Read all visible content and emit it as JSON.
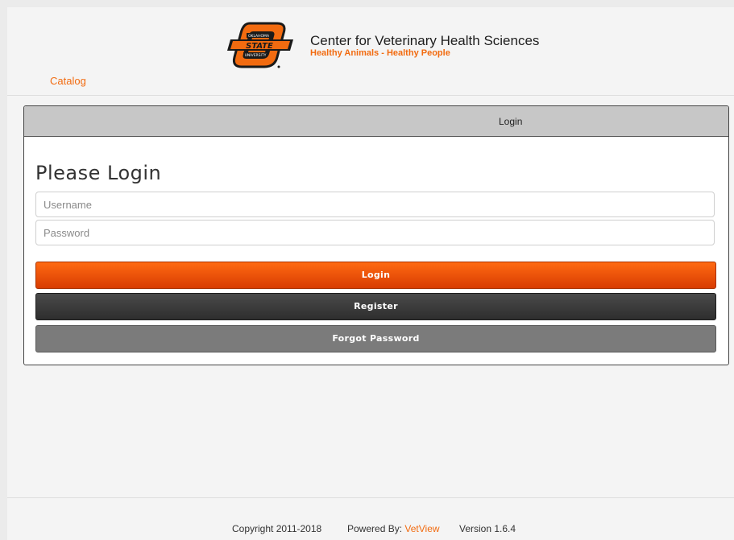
{
  "header": {
    "logo_text_top": "OKLAHOMA",
    "logo_text_middle": "STATE",
    "logo_text_bottom": "UNIVERSITY",
    "logo_mark": "OSU brand logo",
    "title": "Center for Veterinary Health Sciences",
    "tagline": "Healthy Animals - Healthy People",
    "brand_color": "#f26b10"
  },
  "nav": {
    "catalog_label": "Catalog"
  },
  "login_panel": {
    "header_label": "Login",
    "heading": "Please Login",
    "username_placeholder": "Username",
    "password_placeholder": "Password",
    "login_button": "Login",
    "register_button": "Register",
    "forgot_password_button": "Forgot Password"
  },
  "footer": {
    "copyright": "Copyright 2011-2018",
    "powered_by_label": "Powered By:",
    "powered_by_link": "VetView",
    "version": "Version 1.6.4"
  }
}
